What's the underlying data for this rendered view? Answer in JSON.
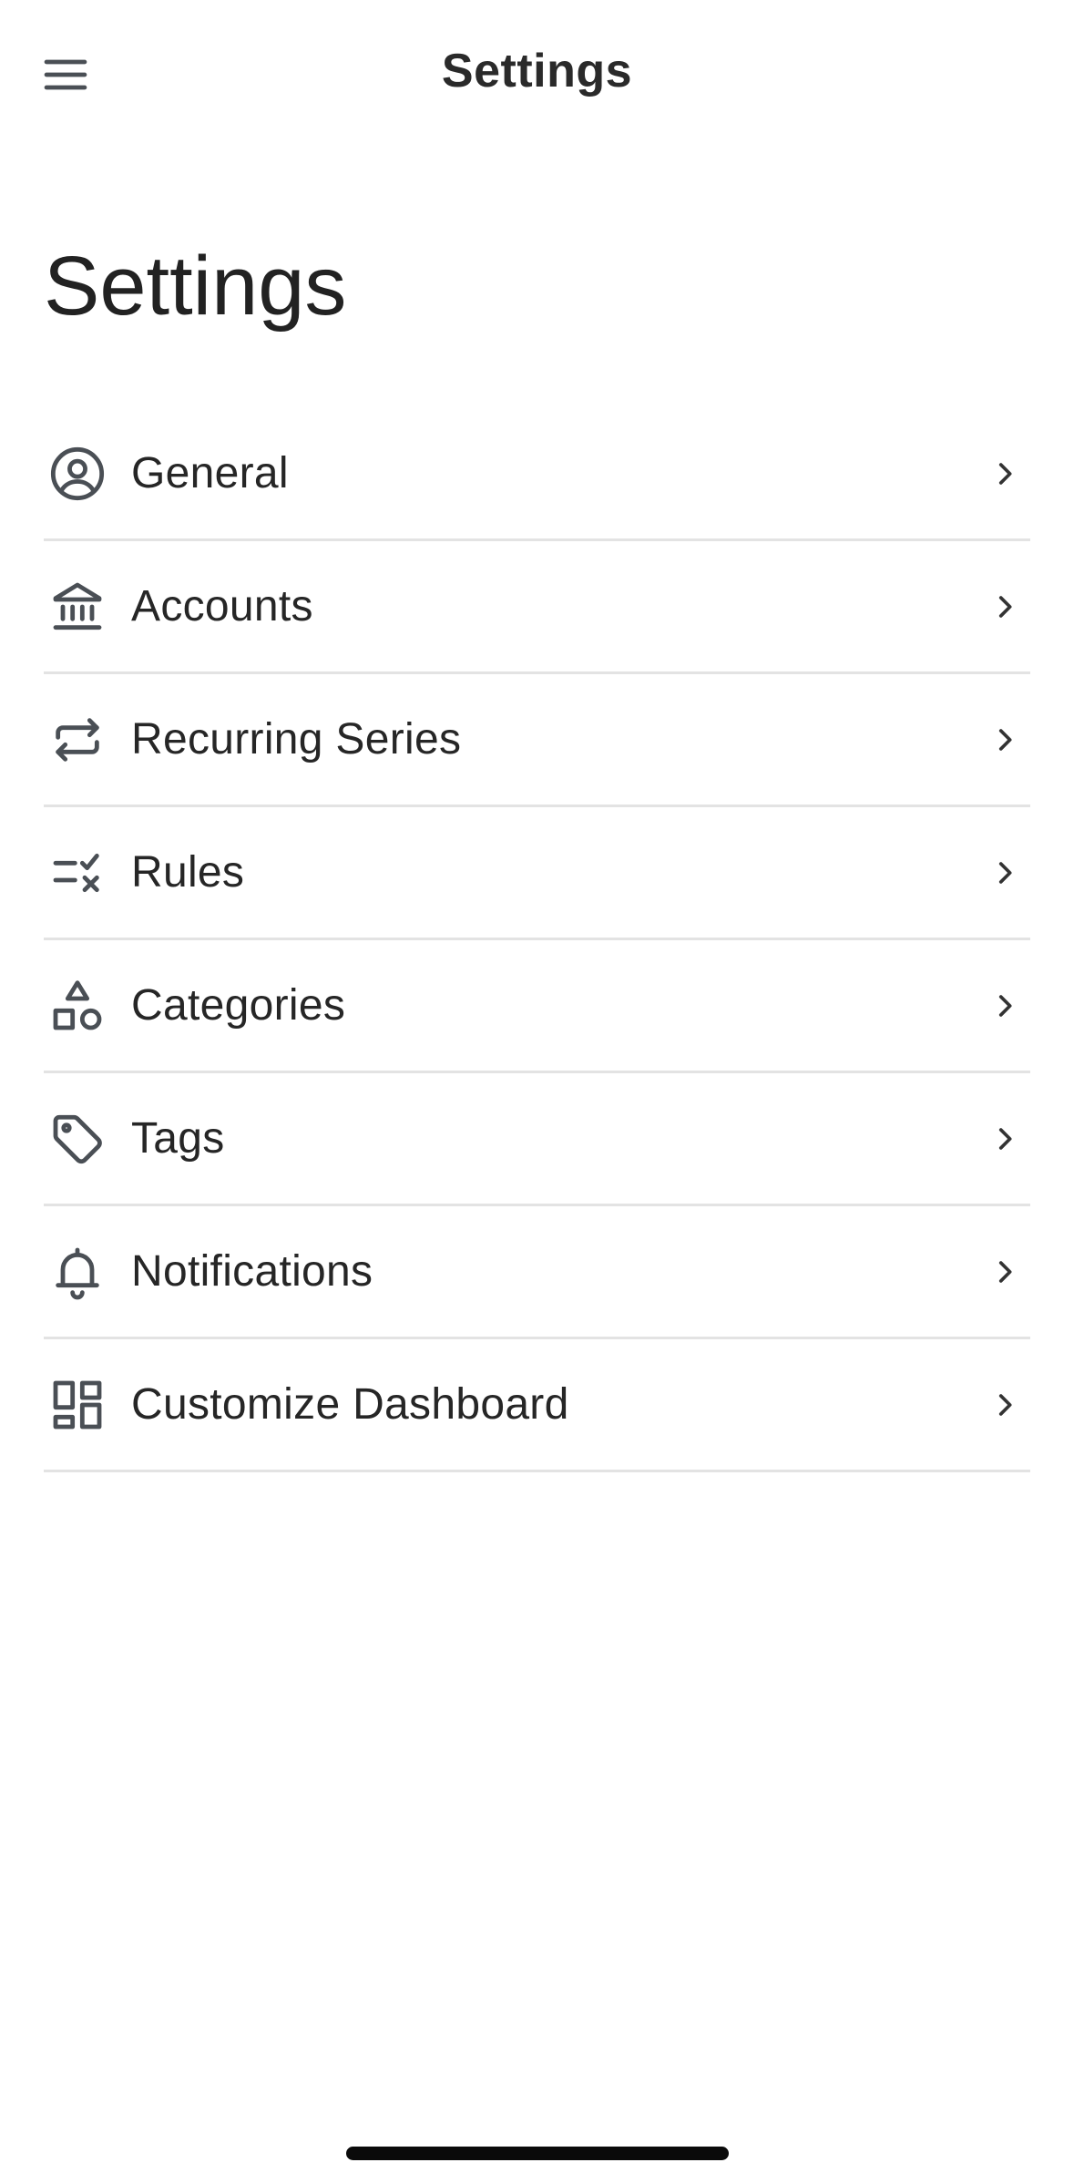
{
  "header": {
    "title": "Settings",
    "menu_icon": "menu-icon"
  },
  "page": {
    "title": "Settings"
  },
  "settings": {
    "items": [
      {
        "label": "General",
        "icon": "user-circle-icon"
      },
      {
        "label": "Accounts",
        "icon": "bank-icon"
      },
      {
        "label": "Recurring Series",
        "icon": "repeat-icon"
      },
      {
        "label": "Rules",
        "icon": "list-check-icon"
      },
      {
        "label": "Categories",
        "icon": "shapes-icon"
      },
      {
        "label": "Tags",
        "icon": "tag-icon"
      },
      {
        "label": "Notifications",
        "icon": "bell-icon"
      },
      {
        "label": "Customize Dashboard",
        "icon": "dashboard-icon"
      }
    ]
  },
  "colors": {
    "text": "#222222",
    "icon": "#4a4f55",
    "divider": "#e3e3e3",
    "background": "#ffffff"
  }
}
